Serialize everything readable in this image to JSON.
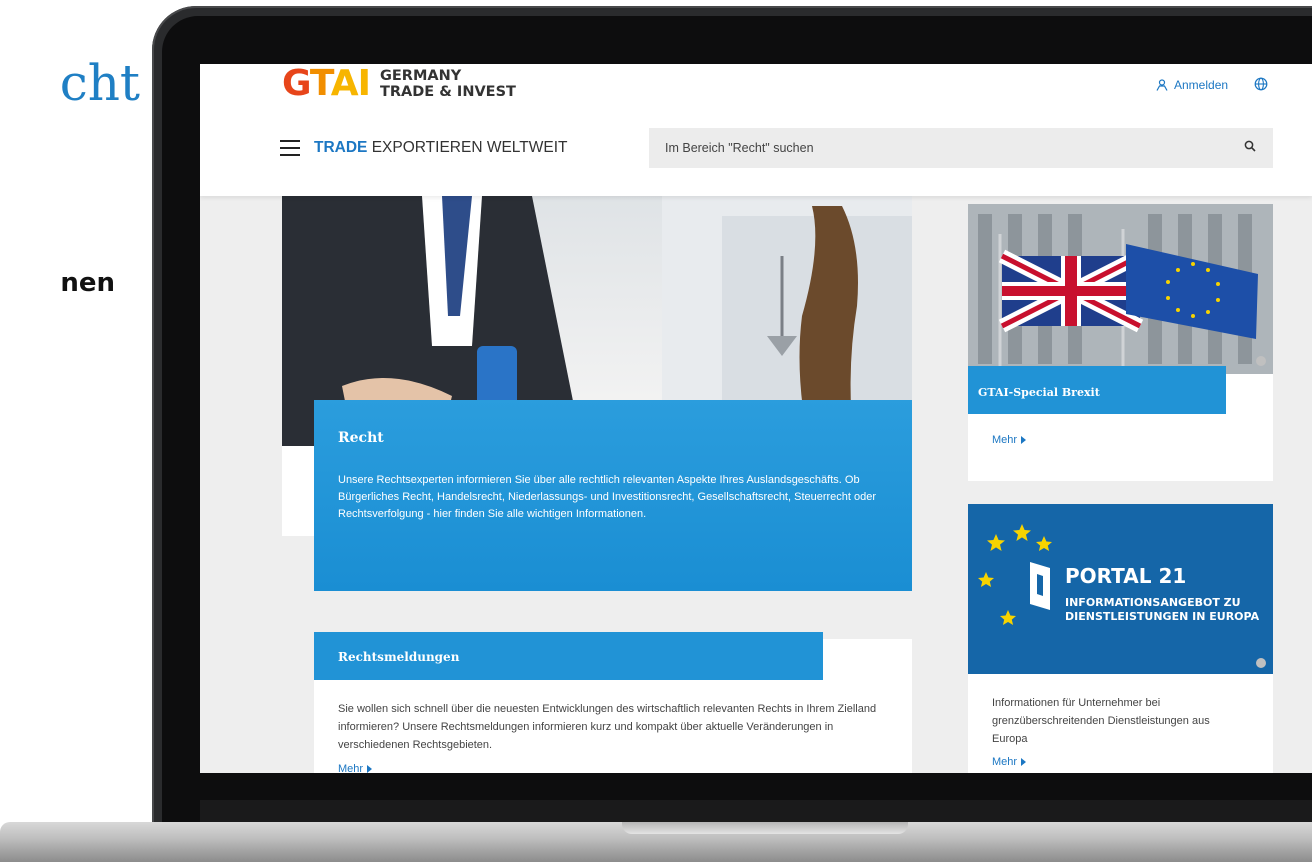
{
  "slide": {
    "heading_fragment": "cht",
    "sub_fragment": "nen"
  },
  "header": {
    "logo_mark": "GTAI",
    "logo_line1": "GERMANY",
    "logo_line2": "TRADE & INVEST",
    "login_label": "Anmelden",
    "section_bold": "TRADE",
    "section_rest": " EXPORTIEREN WELTWEIT",
    "search_placeholder": "Im Bereich \"Recht\" suchen"
  },
  "hero": {
    "title": "Recht",
    "text": "Unsere Rechtsexperten informieren Sie über alle rechtlich relevanten Aspekte Ihres Auslandsgeschäfts. Ob Bürgerliches Recht, Handelsrecht, Niederlassungs- und Investitionsrecht, Gesellschaftsrecht, Steuerrecht oder Rechtsverfolgung - hier finden Sie alle wichtigen Informationen."
  },
  "news": {
    "title": "Rechtsmeldungen",
    "text": "Sie wollen sich schnell über die neuesten Entwicklungen des wirtschaftlich relevanten Rechts in Ihrem Zielland informieren? Unsere Rechtsmeldungen informieren kurz und kompakt über aktuelle Veränderungen in verschiedenen Rechtsgebieten.",
    "more_label": "Mehr"
  },
  "brexit": {
    "title": "GTAI-Special Brexit",
    "more_label": "Mehr"
  },
  "portal": {
    "title": "PORTAL 21",
    "subtitle": "INFORMATIONSANGEBOT ZU DIENSTLEISTUNGEN IN EUROPA",
    "text": "Informationen für Unternehmer bei grenzüberschreitenden Dienstleistungen aus Europa",
    "more_label": "Mehr"
  },
  "colors": {
    "brand_blue": "#1c77c3",
    "panel_blue": "#2193d6",
    "logo_orange": "#f18e00",
    "logo_red": "#e7451a"
  }
}
